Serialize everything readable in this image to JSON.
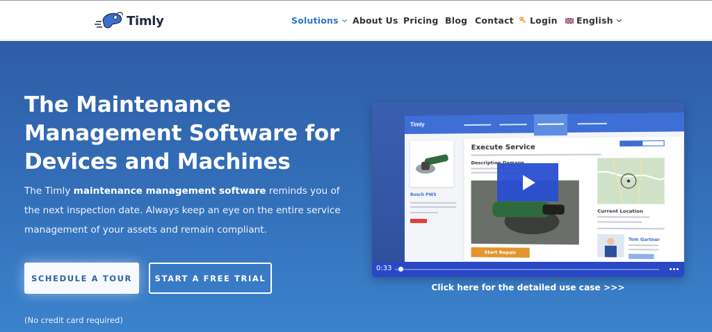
{
  "brand": {
    "name": "Timly"
  },
  "nav": {
    "solutions": "Solutions",
    "about": "About Us",
    "pricing": "Pricing",
    "blog": "Blog",
    "contact": "Contact",
    "login": "Login",
    "language": "English"
  },
  "hero": {
    "title": "The Maintenance Management Software for Devices and Machines",
    "desc_pre": "The Timly ",
    "desc_bold": "maintenance management software",
    "desc_post": " reminds you of the next inspection date. Always keep an eye on the entire service management of your assets and remain compliant.",
    "tour_button": "SCHEDULE A TOUR",
    "trial_button": "START A FREE TRIAL",
    "note": "(No credit card required)"
  },
  "video": {
    "mock_logo": "Timly",
    "screen_title": "Execute Service",
    "description_label": "Description Damage",
    "product_name": "Bosch PWS",
    "current_location": "Current Location",
    "person_name": "Tom Gartner",
    "start_repair": "Start Repair",
    "time": "0:33",
    "progress": 0.02,
    "caption": "Click here for the detailed use case >>>"
  },
  "colors": {
    "accent": "#2d76c7",
    "hero_top": "#2e5da6",
    "hero_bottom": "#3b82cc",
    "video_controls": "#2a48c4"
  }
}
